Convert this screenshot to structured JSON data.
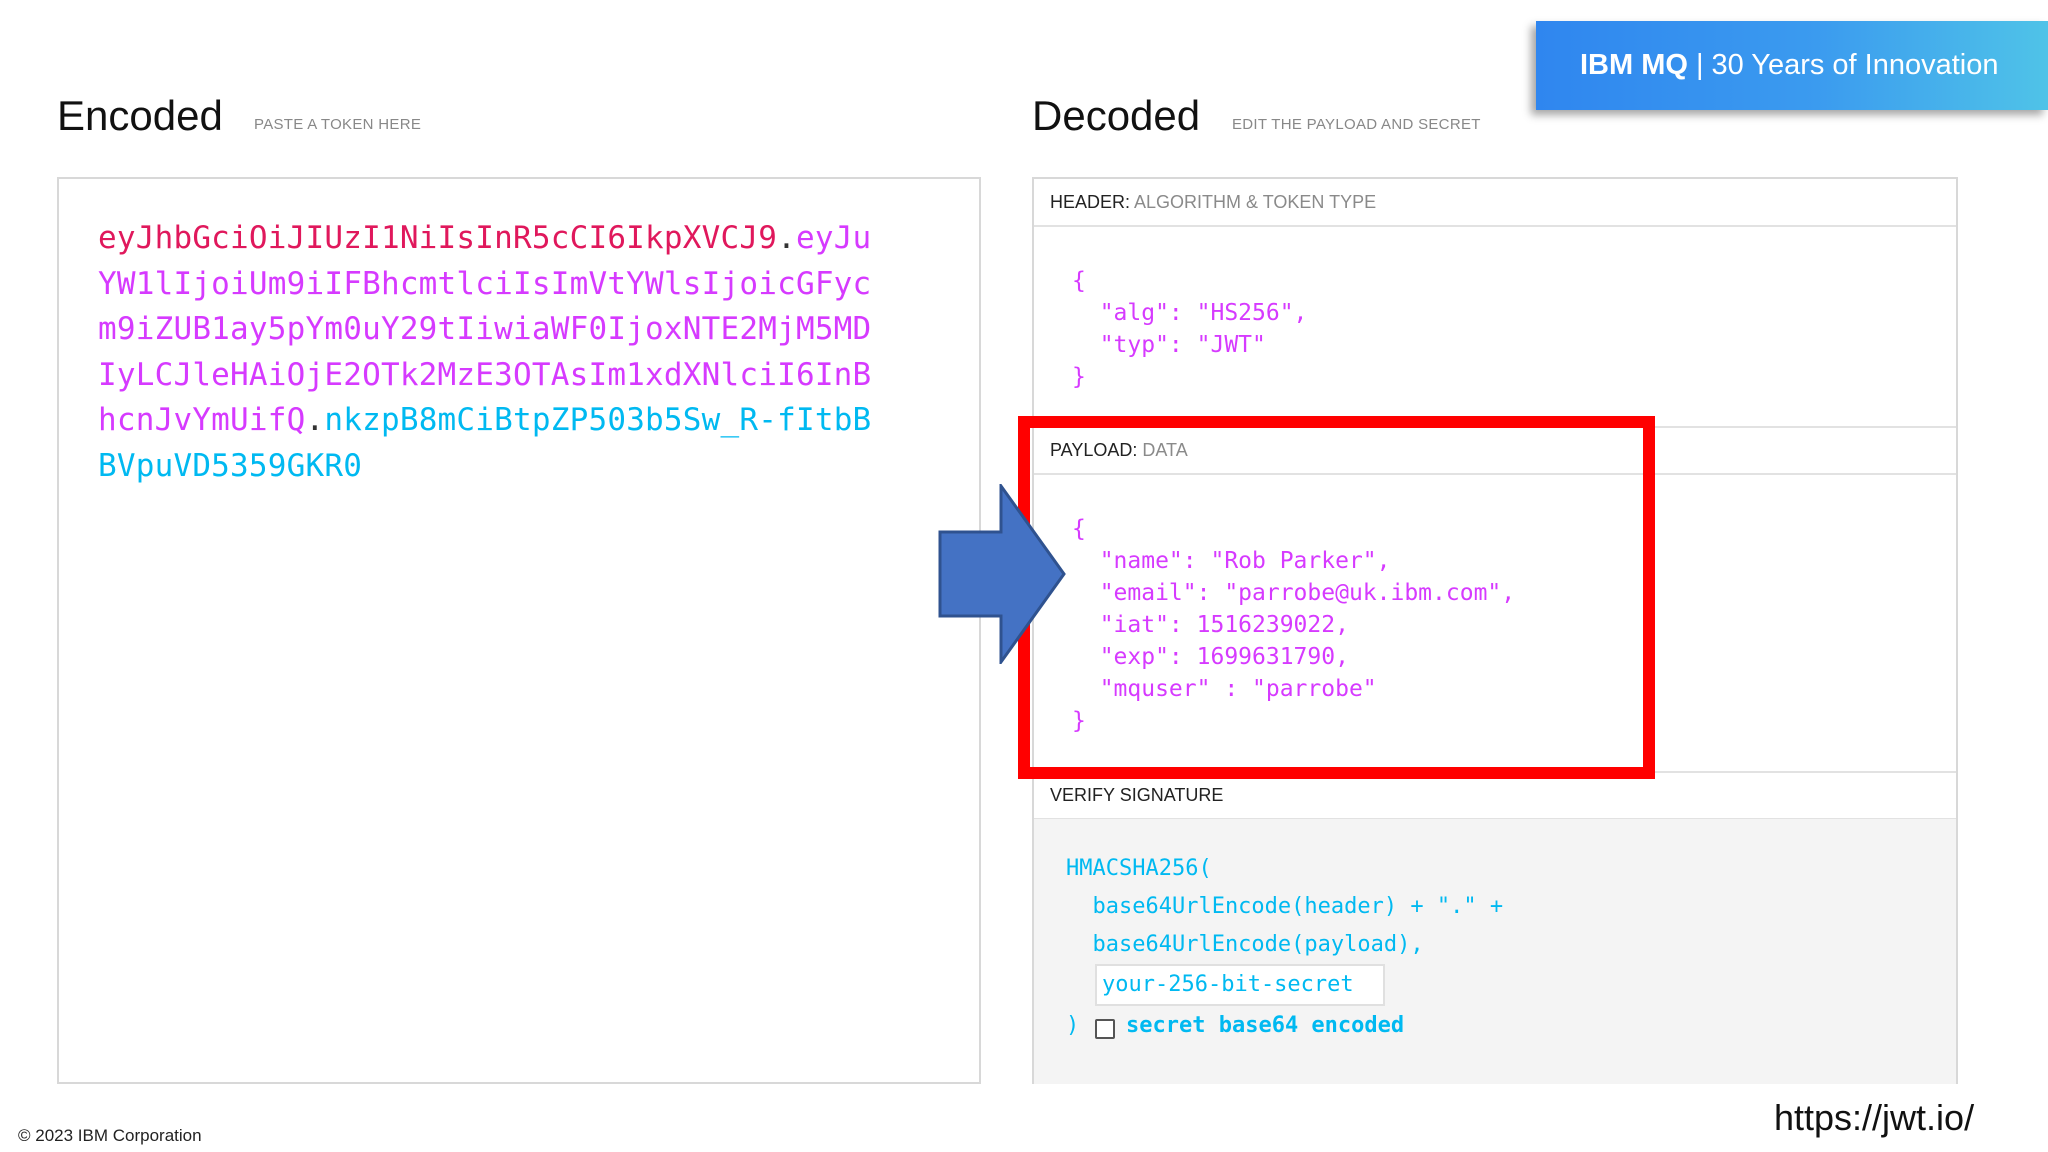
{
  "banner": {
    "product": "IBM MQ",
    "separator": "|",
    "tagline": "30 Years of Innovation"
  },
  "encoded": {
    "title": "Encoded",
    "subtitle": "PASTE A TOKEN HERE",
    "token_header": "eyJhbGciOiJIUzI1NiIsInR5cCI6IkpXVCJ9",
    "dot1": ".",
    "token_payload": "eyJuYW1lIjoiUm9iIFBhcmtlciIsImVtYWlsIjoicGFycm9iZUB1ay5pYm0uY29tIiwiaWF0IjoxNTE2MjM5MDIyLCJleHAiOjE2OTk2MzE3OTAsIm1xdXNlciI6InBhcnJvYmUifQ",
    "dot2": ".",
    "token_signature": "nkzpB8mCiBtpZP503b5Sw_R-fItbBBVpuVD5359GKR0"
  },
  "decoded": {
    "title": "Decoded",
    "subtitle": "EDIT THE PAYLOAD AND SECRET",
    "header_section": {
      "label": "HEADER:",
      "sublabel": "ALGORITHM & TOKEN TYPE",
      "json": "{\n  \"alg\": \"HS256\",\n  \"typ\": \"JWT\"\n}"
    },
    "payload_section": {
      "label": "PAYLOAD:",
      "sublabel": "DATA",
      "json": "{\n  \"name\": \"Rob Parker\",\n  \"email\": \"parrobe@uk.ibm.com\",\n  \"iat\": 1516239022,\n  \"exp\": 1699631790,\n  \"mquser\" : \"parrobe\"\n}"
    },
    "signature_section": {
      "label": "VERIFY SIGNATURE",
      "line1": "HMACSHA256(",
      "line2": "  base64UrlEncode(header) + \".\" +",
      "line3": "  base64UrlEncode(payload),",
      "secret_placeholder": "your-256-bit-secret",
      "closing": ")",
      "checkbox_label": "secret base64 encoded",
      "checkbox_checked": false
    }
  },
  "footer": {
    "copyright": "© 2023 IBM Corporation",
    "url": "https://jwt.io/"
  },
  "colors": {
    "header_part": "#e0185c",
    "payload_part": "#d63aff",
    "signature_part": "#00b9f1",
    "highlight": "#ff0000",
    "arrow": "#4472c4"
  },
  "icons": {
    "arrow": "right-arrow-icon",
    "checkbox": "checkbox-icon"
  }
}
